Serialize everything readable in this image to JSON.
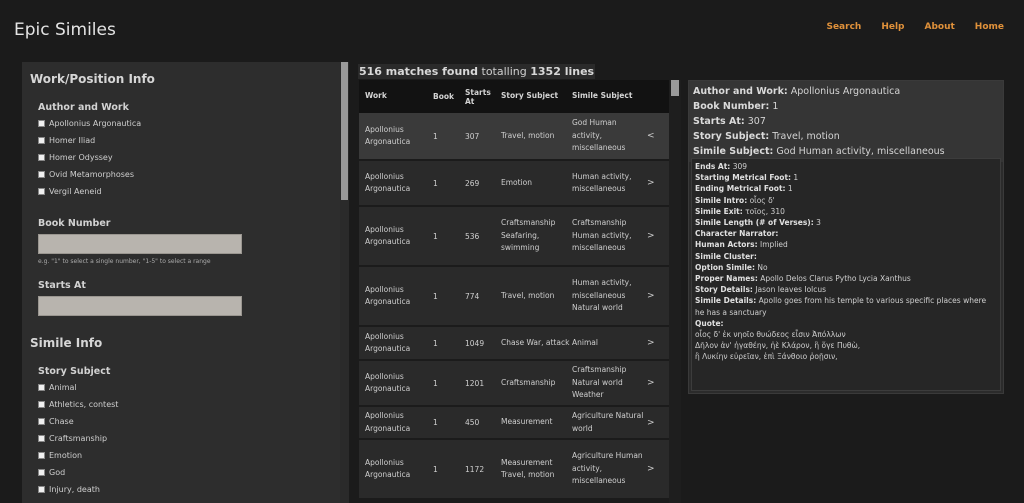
{
  "app": {
    "title": "Epic Similes"
  },
  "nav": [
    "Search",
    "Help",
    "About",
    "Home"
  ],
  "filters": {
    "section1_title": "Work/Position Info",
    "author_title": "Author and Work",
    "authors": [
      "Apollonius Argonautica",
      "Homer Iliad",
      "Homer Odyssey",
      "Ovid Metamorphoses",
      "Vergil Aeneid"
    ],
    "book_title": "Book Number",
    "book_hint": "e.g. \"1\" to select a single number, \"1-5\" to select a range",
    "starts_title": "Starts At",
    "section2_title": "Simile Info",
    "story_title": "Story Subject",
    "story_subjects": [
      "Animal",
      "Athletics, contest",
      "Chase",
      "Craftsmanship",
      "Emotion",
      "God",
      "Injury, death"
    ]
  },
  "summary": {
    "matches": "516 matches found",
    "mid": "totalling",
    "lines": "1352 lines"
  },
  "table": {
    "headers": {
      "work": "Work",
      "book": "Book",
      "starts": "Starts At",
      "story": "Story Subject",
      "simile": "Simile Subject"
    },
    "rows": [
      {
        "work": "Apollonius Argonautica",
        "book": "1",
        "starts": "307",
        "story": "Travel, motion",
        "simile": "God Human activity, miscellaneous",
        "arrow": "<"
      },
      {
        "work": "Apollonius Argonautica",
        "book": "1",
        "starts": "269",
        "story": "Emotion",
        "simile": "Human activity, miscellaneous",
        "arrow": ">"
      },
      {
        "work": "Apollonius Argonautica",
        "book": "1",
        "starts": "536",
        "story": "Craftsmanship Seafaring, swimming",
        "simile": "Craftsmanship Human activity, miscellaneous",
        "arrow": ">"
      },
      {
        "work": "Apollonius Argonautica",
        "book": "1",
        "starts": "774",
        "story": "Travel, motion",
        "simile": "Human activity, miscellaneous Natural world",
        "arrow": ">"
      },
      {
        "work": "Apollonius Argonautica",
        "book": "1",
        "starts": "1049",
        "story": "Chase War, attack",
        "simile": "Animal",
        "arrow": ">"
      },
      {
        "work": "Apollonius Argonautica",
        "book": "1",
        "starts": "1201",
        "story": "Craftsmanship",
        "simile": "Craftsmanship Natural world Weather",
        "arrow": ">"
      },
      {
        "work": "Apollonius Argonautica",
        "book": "1",
        "starts": "450",
        "story": "Measurement",
        "simile": "Agriculture Natural world",
        "arrow": ">"
      },
      {
        "work": "Apollonius Argonautica",
        "book": "1",
        "starts": "1172",
        "story": "Measurement Travel, motion",
        "simile": "Agriculture Human activity, miscellaneous",
        "arrow": ">"
      }
    ]
  },
  "detail": {
    "author_label": "Author and Work",
    "author_value": "Apollonius Argonautica",
    "book_label": "Book Number",
    "book_value": "1",
    "starts_label": "Starts At",
    "starts_value": "307",
    "story_label": "Story Subject",
    "story_value": "Travel, motion",
    "simile_label": "Simile Subject",
    "simile_value": "God Human activity, miscellaneous",
    "fields": [
      {
        "label": "Ends At",
        "value": "309"
      },
      {
        "label": "Starting Metrical Foot",
        "value": "1"
      },
      {
        "label": "Ending Metrical Foot",
        "value": "1"
      },
      {
        "label": "Simile Intro",
        "value": "οἷος δ'"
      },
      {
        "label": "Simile Exit",
        "value": "τοῖος, 310"
      },
      {
        "label": "Simile Length (# of Verses)",
        "value": "3"
      },
      {
        "label": "Character Narrator",
        "value": ""
      },
      {
        "label": "Human Actors",
        "value": "Implied"
      },
      {
        "label": "Simile Cluster",
        "value": ""
      },
      {
        "label": "Option Simile",
        "value": "No"
      },
      {
        "label": "Proper Names",
        "value": "Apollo Delos Clarus Pytho Lycia Xanthus"
      },
      {
        "label": "Story Details",
        "value": "Jason leaves Iolcus"
      },
      {
        "label": "Simile Details",
        "value": "Apollo goes from his temple to various specific places where he has a sanctuary"
      }
    ],
    "quote_label": "Quote:",
    "quote_lines": [
      "οἷος δ' ἐκ νηοῖο θυώδεος εἶσιν Ἀπόλλων",
      "Δῆλον ἀν' ἠγαθέην, ἠὲ Κλάρον, ἢ ὅγε Πυθὼ,",
      "ἢ Λυκίην εὐρεῖαν, ἐπὶ Ξάνθοιο ῥοῇσιν,"
    ]
  }
}
